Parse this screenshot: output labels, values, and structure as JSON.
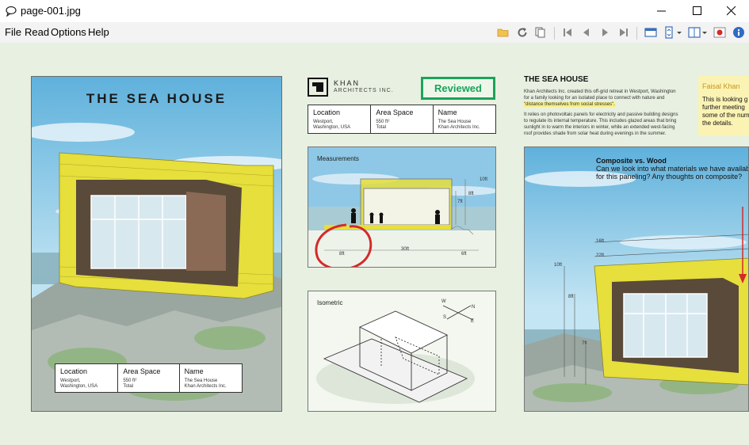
{
  "window": {
    "title": "page-001.jpg"
  },
  "menu": {
    "file": "File",
    "read": "Read",
    "options": "Options",
    "help": "Help"
  },
  "toolbar": {
    "icons": [
      "open-folder-icon",
      "rotate-icon",
      "copy-icon",
      "first-page-icon",
      "prev-page-icon",
      "next-page-icon",
      "last-page-icon",
      "single-view-icon",
      "zoom-icon",
      "two-page-view-icon",
      "record-icon",
      "info-icon"
    ]
  },
  "poster": {
    "title": "THE SEA HOUSE",
    "table": {
      "location_head": "Location",
      "location_body1": "Westport,",
      "location_body2": "Washington, USA",
      "area_head": "Area Space",
      "area_body1": "550 ft²",
      "area_body2": "Total",
      "name_head": "Name",
      "name_body1": "The Sea House",
      "name_body2": "Khan Architects Inc."
    }
  },
  "middle": {
    "logo_name": "KHAN",
    "logo_sub": "ARCHITECTS INC.",
    "reviewed": "Reviewed",
    "table": {
      "location_head": "Location",
      "location_body1": "Westport,",
      "location_body2": "Washington, USA",
      "area_head": "Area Space",
      "area_body1": "550 ft²",
      "area_body2": "Total",
      "name_head": "Name",
      "name_body1": "The Sea House",
      "name_body2": "Khan Architects Inc."
    },
    "measurements": {
      "label": "Measurements",
      "d10": "10ft",
      "d8": "8ft",
      "d7": "7ft",
      "d8b": "8ft",
      "d30": "30ft",
      "d6": "6ft"
    },
    "isometric": {
      "label": "Isometric",
      "w": "W",
      "n": "N",
      "s": "S",
      "e": "E"
    }
  },
  "right": {
    "title": "THE SEA HOUSE",
    "para1a": "Khan Architects Inc. created this off-grid retreat in Westport, Washington",
    "para1b": "for a family looking for an isolated place to connect with nature and",
    "para1c": "\"distance themselves from social stresses\".",
    "para2a": "It relies on photovoltaic panels for electricity and passive building designs",
    "para2b": "to regulate its internal temperature. This includes glazed areas that bring",
    "para2c": "sunlight in to warm the interiors in winter, while an extended west-facing",
    "para2d": "roof provides shade from solar heat during evenings in the summer.",
    "note_name": "Faisal Khan",
    "note_l1": "This is looking g",
    "note_l2": "further meeting",
    "note_l3": "some of the num",
    "note_l4": "the details.",
    "comment_title": "Composite vs. Wood",
    "comment_l1": "Can we look into what materials we have availab",
    "comment_l2": "for this paneling? Any thoughts on composite?",
    "dims": {
      "d16": "16ft",
      "d22": "22ft",
      "d10": "10ft",
      "d8": "8ft",
      "d7": "7ft"
    }
  },
  "colors": {
    "content_bg": "#e8f0e1",
    "reviewed": "#1aa45a",
    "house_yellow": "#e6df3c",
    "sky": "#8ec8e6",
    "annotation_red": "#d42a2a"
  }
}
